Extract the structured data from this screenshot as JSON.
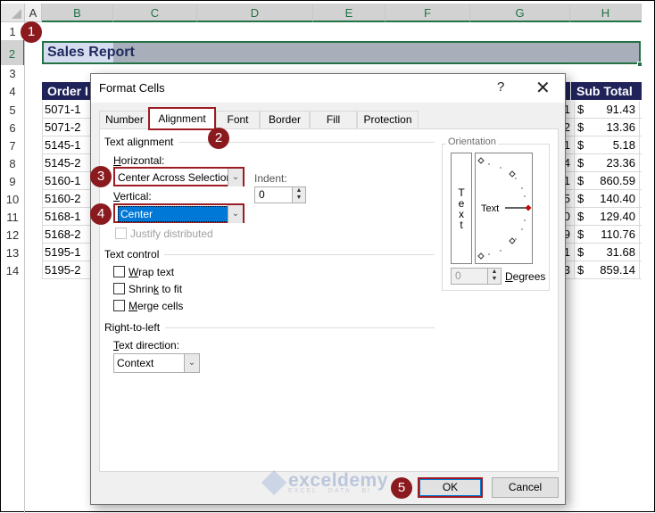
{
  "spreadsheet": {
    "column_headers": [
      "A",
      "B",
      "C",
      "D",
      "E",
      "F",
      "G",
      "H"
    ],
    "row_headers": [
      "1",
      "2",
      "3",
      "4",
      "5",
      "6",
      "7",
      "8",
      "9",
      "10",
      "11",
      "12",
      "13",
      "14"
    ],
    "title_cell": "Sales Report",
    "table_headers": {
      "order_id": "Order I",
      "sub_total": "Sub Total"
    },
    "rows": [
      {
        "order_id": "5071-1",
        "g_partial": "1",
        "currency": "$",
        "sub_total": "91.43"
      },
      {
        "order_id": "5071-2",
        "g_partial": "2",
        "currency": "$",
        "sub_total": "13.36"
      },
      {
        "order_id": "5145-1",
        "g_partial": "1",
        "currency": "$",
        "sub_total": "5.18"
      },
      {
        "order_id": "5145-2",
        "g_partial": "4",
        "currency": "$",
        "sub_total": "23.36"
      },
      {
        "order_id": "5160-1",
        "g_partial": "1",
        "currency": "$",
        "sub_total": "860.59"
      },
      {
        "order_id": "5160-2",
        "g_partial": "5",
        "currency": "$",
        "sub_total": "140.40"
      },
      {
        "order_id": "5168-1",
        "g_partial": "0",
        "currency": "$",
        "sub_total": "129.40"
      },
      {
        "order_id": "5168-2",
        "g_partial": "9",
        "currency": "$",
        "sub_total": "110.76"
      },
      {
        "order_id": "5195-1",
        "g_partial": "1",
        "currency": "$",
        "sub_total": "31.68"
      },
      {
        "order_id": "5195-2",
        "g_partial": "3",
        "currency": "$",
        "sub_total": "859.14"
      }
    ],
    "colors": {
      "header_fill": "#20235a",
      "title_fill": "#a9aebb",
      "selection_border": "#217346"
    }
  },
  "dialog": {
    "title": "Format Cells",
    "help_label": "?",
    "close_label": "✕",
    "tabs": [
      {
        "label": "Number",
        "active": false
      },
      {
        "label": "Alignment",
        "active": true
      },
      {
        "label": "Font",
        "active": false
      },
      {
        "label": "Border",
        "active": false
      },
      {
        "label": "Fill",
        "active": false
      },
      {
        "label": "Protection",
        "active": false
      }
    ],
    "text_alignment": {
      "section_label": "Text alignment",
      "horizontal_label_u": "H",
      "horizontal_label_rest": "orizontal:",
      "horizontal_value": "Center Across Selection",
      "vertical_label_u": "V",
      "vertical_label_rest": "ertical:",
      "vertical_value": "Center",
      "indent_label": "Indent:",
      "indent_value": "0",
      "justify_distributed_label": "Justify distributed",
      "justify_distributed_checked": false
    },
    "text_control": {
      "section_label": "Text control",
      "wrap_text": {
        "u": "W",
        "rest": "rap text",
        "checked": false
      },
      "shrink_to_fit": {
        "pre": "Shrin",
        "u": "k",
        "rest": " to fit",
        "checked": false
      },
      "merge_cells": {
        "u": "M",
        "rest": "erge cells",
        "checked": false
      }
    },
    "right_to_left": {
      "section_label": "Right-to-left",
      "text_direction_label_u": "T",
      "text_direction_label_rest": "ext direction:",
      "text_direction_value": "Context"
    },
    "orientation": {
      "section_label": "Orientation",
      "vertical_text_letters": [
        "T",
        "e",
        "x",
        "t"
      ],
      "dial_text": "Text",
      "degrees_value": "0",
      "degrees_label_u": "D",
      "degrees_label_rest": "egrees"
    },
    "buttons": {
      "ok": "OK",
      "cancel": "Cancel"
    },
    "watermark": {
      "main": "exceldemy",
      "sub": "EXCEL · DATA · BI"
    }
  },
  "callouts": [
    "1",
    "2",
    "3",
    "4",
    "5"
  ],
  "accent_color": "#8b1a1f"
}
